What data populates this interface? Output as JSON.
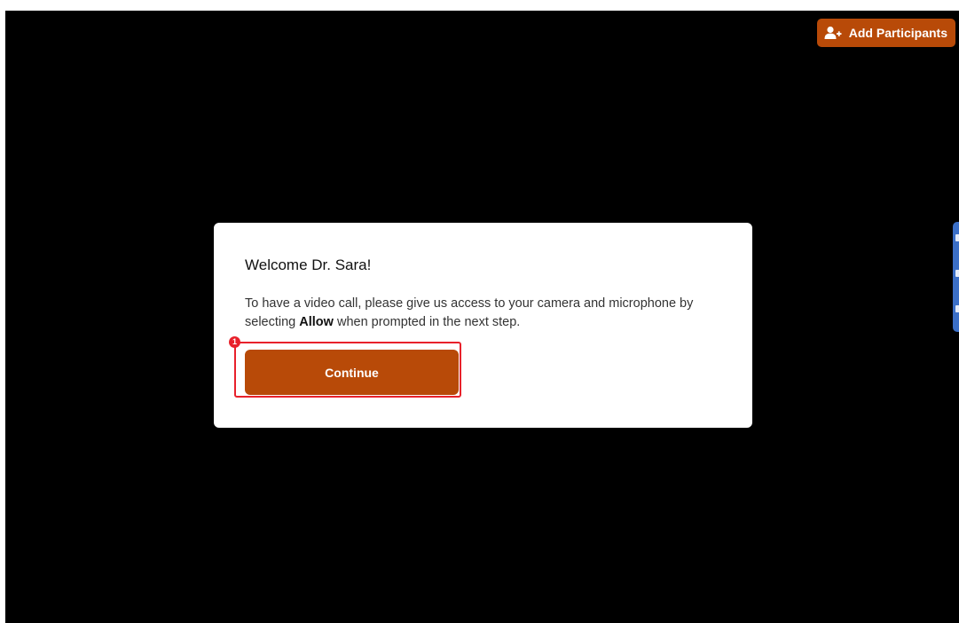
{
  "header": {
    "add_participants_label": "Add Participants",
    "add_participants_icon": "add-user-icon",
    "accent_color": "#b84a08"
  },
  "dialog": {
    "title": "Welcome Dr. Sara!",
    "body_before": "To have a video call, please give us access to your camera and microphone by selecting ",
    "body_bold": "Allow",
    "body_after": " when prompted in the next step.",
    "continue_label": "Continue",
    "step_badge": "1",
    "highlight_color": "#e8212b"
  },
  "side_panel": {
    "icons": [
      "document-icon",
      "thumbs-up-icon",
      "back-arrow-icon"
    ],
    "color": "#3b6fc7"
  }
}
